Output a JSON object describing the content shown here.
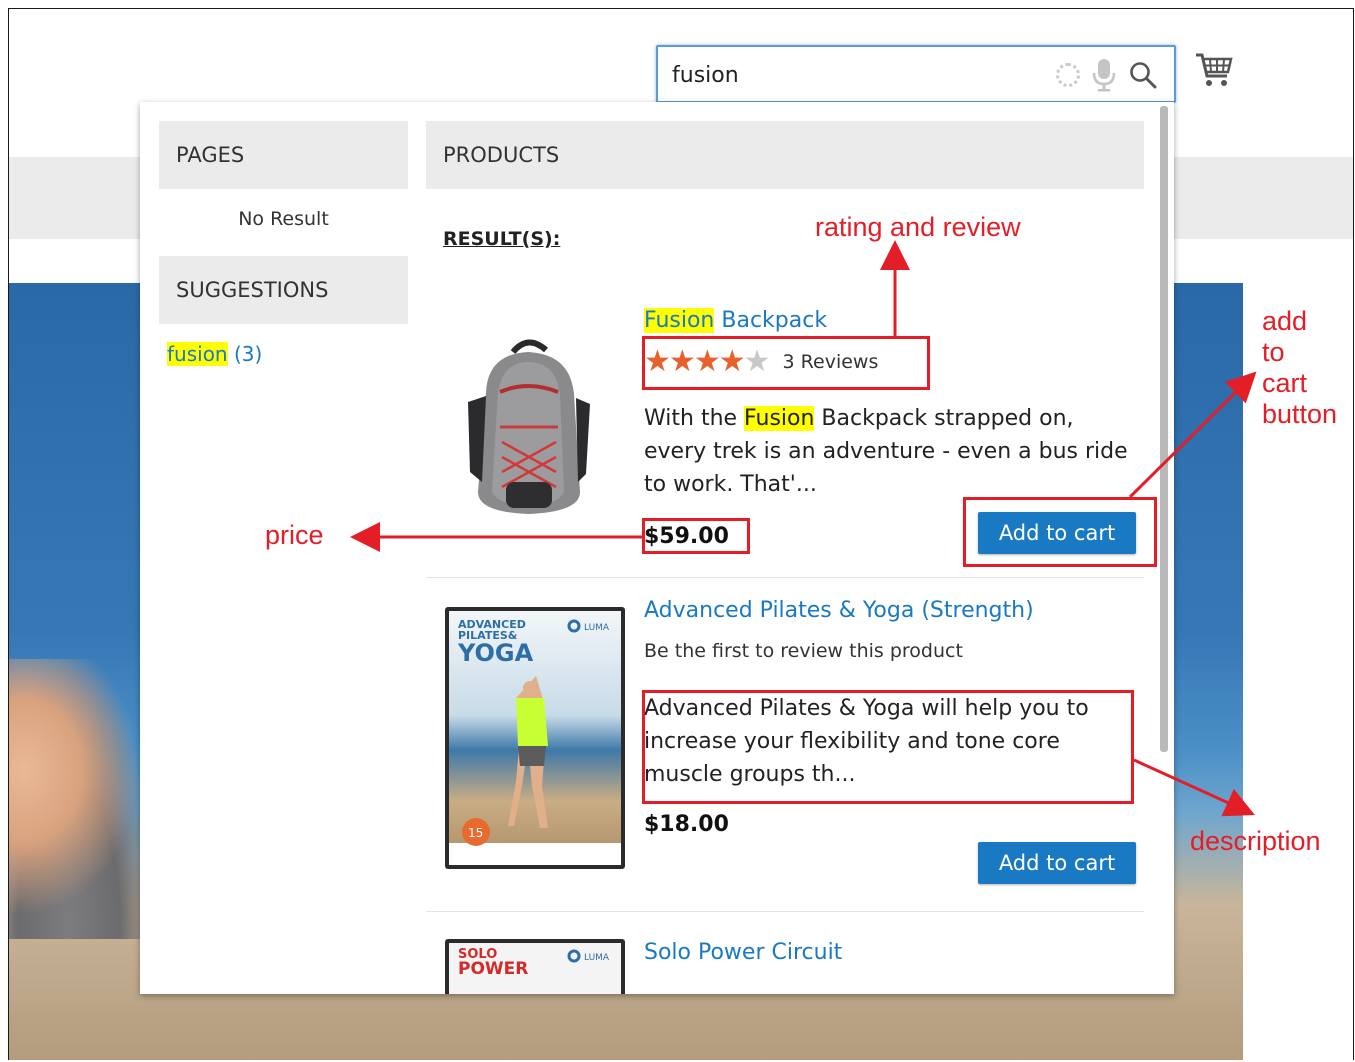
{
  "search": {
    "query": "fusion"
  },
  "autocomplete": {
    "pages_heading": "PAGES",
    "pages_empty": "No Result",
    "suggestions_heading": "SUGGESTIONS",
    "suggestion": {
      "term": "fusion",
      "count": "(3)"
    },
    "products_heading": "PRODUCTS",
    "results_label": "RESULT(S):",
    "products": [
      {
        "name_highlight": "Fusion",
        "name_rest": " Backpack",
        "rating_percent": 70,
        "stars": 5,
        "reviews": "3 Reviews",
        "desc_pre": "With the ",
        "desc_highlight": "Fusion",
        "desc_post": " Backpack strapped on, every trek is an adventure - even a bus ride to work. That'...",
        "price": "$59.00",
        "button": "Add to cart"
      },
      {
        "name": "Advanced Pilates & Yoga (Strength)",
        "review_prompt": "Be the first to review this product",
        "desc": "Advanced Pilates & Yoga will help you to increase your flexibility and tone core muscle groups th...",
        "price": "$18.00",
        "button": "Add to cart",
        "cover_lines": [
          "ADVANCED",
          "PILATES&",
          "YOGA"
        ],
        "cover_brand": "LUMA",
        "cover_badge": "15"
      },
      {
        "name": "Solo Power Circuit",
        "cover_lines": [
          "SOLO",
          "POWER"
        ],
        "cover_brand": "LUMA"
      }
    ]
  },
  "annotations": {
    "rating": "rating and review",
    "cart_button": [
      "add",
      "to",
      "cart",
      "button"
    ],
    "price": "price",
    "description": "description"
  },
  "colors": {
    "accent": "#1979c3",
    "highlight": "#ffff00",
    "annotation": "#e41e26",
    "star": "#e8612c"
  }
}
